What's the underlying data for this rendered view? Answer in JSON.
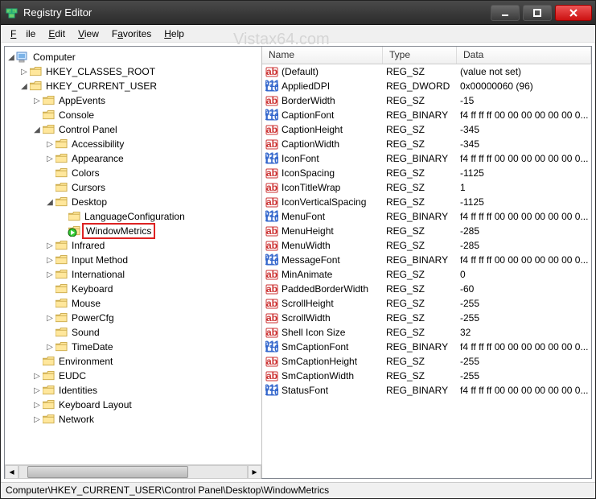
{
  "window": {
    "title": "Registry Editor"
  },
  "watermark": "Vistax64.com",
  "menu": {
    "file": "File",
    "edit": "Edit",
    "view": "View",
    "fav": "Favorites",
    "help": "Help"
  },
  "list_header": {
    "name": "Name",
    "type": "Type",
    "data": "Data"
  },
  "tree": {
    "root": "Computer",
    "hkcr": "HKEY_CLASSES_ROOT",
    "hkcu": "HKEY_CURRENT_USER",
    "appevents": "AppEvents",
    "console": "Console",
    "cpanel": "Control Panel",
    "access": "Accessibility",
    "appear": "Appearance",
    "colors": "Colors",
    "cursors": "Cursors",
    "desktop": "Desktop",
    "langcfg": "LanguageConfiguration",
    "winmetrics": "WindowMetrics",
    "infrared": "Infrared",
    "inputm": "Input Method",
    "intl": "International",
    "keyboard": "Keyboard",
    "mouse": "Mouse",
    "powercfg": "PowerCfg",
    "sound": "Sound",
    "timedate": "TimeDate",
    "env": "Environment",
    "eudc": "EUDC",
    "ident": "Identities",
    "kblayout": "Keyboard Layout",
    "network": "Network"
  },
  "rows": [
    {
      "icon": "sz",
      "name": "(Default)",
      "type": "REG_SZ",
      "data": "(value not set)"
    },
    {
      "icon": "bin",
      "name": "AppliedDPI",
      "type": "REG_DWORD",
      "data": "0x00000060 (96)"
    },
    {
      "icon": "sz",
      "name": "BorderWidth",
      "type": "REG_SZ",
      "data": "-15"
    },
    {
      "icon": "bin",
      "name": "CaptionFont",
      "type": "REG_BINARY",
      "data": "f4 ff ff ff 00 00 00 00 00 00 0..."
    },
    {
      "icon": "sz",
      "name": "CaptionHeight",
      "type": "REG_SZ",
      "data": "-345"
    },
    {
      "icon": "sz",
      "name": "CaptionWidth",
      "type": "REG_SZ",
      "data": "-345"
    },
    {
      "icon": "bin",
      "name": "IconFont",
      "type": "REG_BINARY",
      "data": "f4 ff ff ff 00 00 00 00 00 00 0..."
    },
    {
      "icon": "sz",
      "name": "IconSpacing",
      "type": "REG_SZ",
      "data": "-1125"
    },
    {
      "icon": "sz",
      "name": "IconTitleWrap",
      "type": "REG_SZ",
      "data": "1"
    },
    {
      "icon": "sz",
      "name": "IconVerticalSpacing",
      "type": "REG_SZ",
      "data": "-1125"
    },
    {
      "icon": "bin",
      "name": "MenuFont",
      "type": "REG_BINARY",
      "data": "f4 ff ff ff 00 00 00 00 00 00 0..."
    },
    {
      "icon": "sz",
      "name": "MenuHeight",
      "type": "REG_SZ",
      "data": "-285"
    },
    {
      "icon": "sz",
      "name": "MenuWidth",
      "type": "REG_SZ",
      "data": "-285"
    },
    {
      "icon": "bin",
      "name": "MessageFont",
      "type": "REG_BINARY",
      "data": "f4 ff ff ff 00 00 00 00 00 00 0..."
    },
    {
      "icon": "sz",
      "name": "MinAnimate",
      "type": "REG_SZ",
      "data": "0"
    },
    {
      "icon": "sz",
      "name": "PaddedBorderWidth",
      "type": "REG_SZ",
      "data": "-60"
    },
    {
      "icon": "sz",
      "name": "ScrollHeight",
      "type": "REG_SZ",
      "data": "-255"
    },
    {
      "icon": "sz",
      "name": "ScrollWidth",
      "type": "REG_SZ",
      "data": "-255"
    },
    {
      "icon": "sz",
      "name": "Shell Icon Size",
      "type": "REG_SZ",
      "data": "32"
    },
    {
      "icon": "bin",
      "name": "SmCaptionFont",
      "type": "REG_BINARY",
      "data": "f4 ff ff ff 00 00 00 00 00 00 0..."
    },
    {
      "icon": "sz",
      "name": "SmCaptionHeight",
      "type": "REG_SZ",
      "data": "-255"
    },
    {
      "icon": "sz",
      "name": "SmCaptionWidth",
      "type": "REG_SZ",
      "data": "-255"
    },
    {
      "icon": "bin",
      "name": "StatusFont",
      "type": "REG_BINARY",
      "data": "f4 ff ff ff 00 00 00 00 00 00 0..."
    }
  ],
  "statusbar": "Computer\\HKEY_CURRENT_USER\\Control Panel\\Desktop\\WindowMetrics"
}
